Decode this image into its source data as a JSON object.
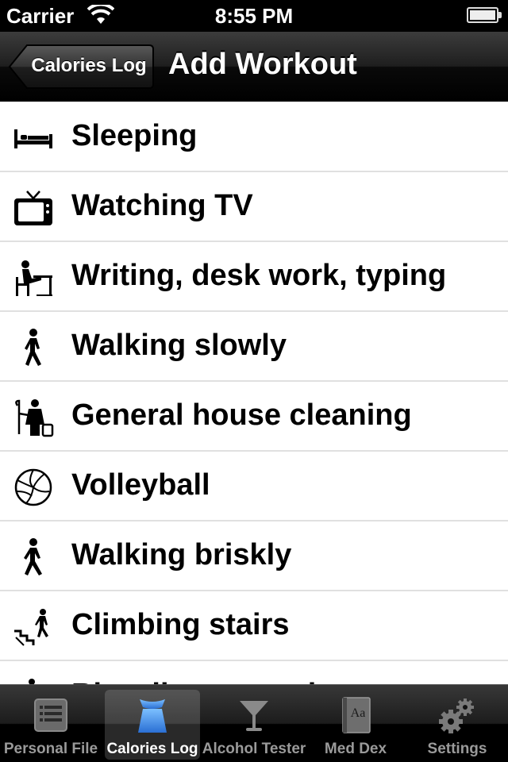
{
  "status_bar": {
    "carrier": "Carrier",
    "time": "8:55 PM"
  },
  "nav": {
    "back_label": "Calories Log",
    "title": "Add Workout"
  },
  "workouts": [
    {
      "label": "Sleeping",
      "icon": "bed-icon"
    },
    {
      "label": "Watching TV",
      "icon": "tv-icon"
    },
    {
      "label": "Writing, desk work, typing",
      "icon": "desk-work-icon"
    },
    {
      "label": "Walking slowly",
      "icon": "walking-icon"
    },
    {
      "label": "General house cleaning",
      "icon": "cleaning-icon"
    },
    {
      "label": "Volleyball",
      "icon": "volleyball-icon"
    },
    {
      "label": "Walking briskly",
      "icon": "walking-icon"
    },
    {
      "label": "Climbing stairs",
      "icon": "stairs-icon"
    },
    {
      "label": "Bicycling, casual",
      "icon": "bicycle-icon"
    }
  ],
  "tabs": [
    {
      "label": "Personal File",
      "icon": "list-icon",
      "active": false
    },
    {
      "label": "Calories Log",
      "icon": "scale-icon",
      "active": true
    },
    {
      "label": "Alcohol Tester",
      "icon": "martini-glass-icon",
      "active": false
    },
    {
      "label": "Med Dex",
      "icon": "book-icon",
      "active": false
    },
    {
      "label": "Settings",
      "icon": "gears-icon",
      "active": false
    }
  ],
  "colors": {
    "active_tab_icon": "#3f8fe6",
    "inactive_tab": "#9a9a9a"
  }
}
